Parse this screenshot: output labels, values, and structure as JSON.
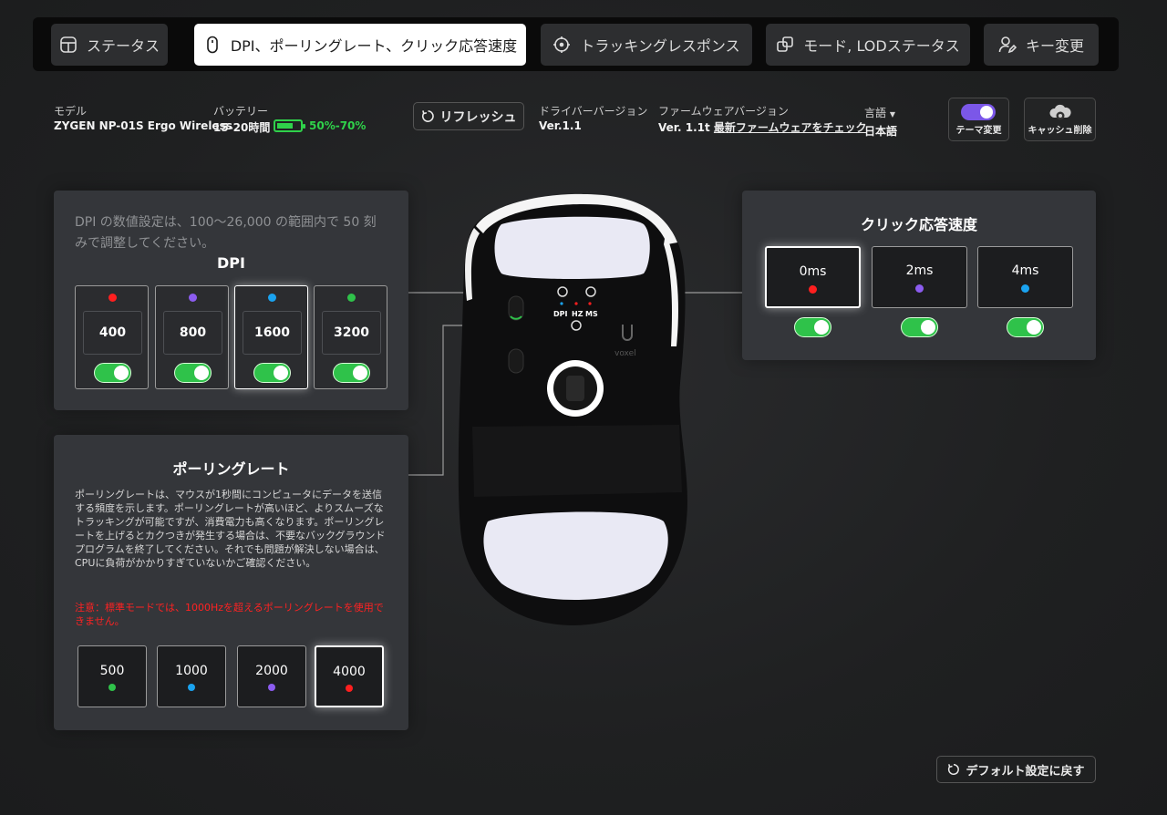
{
  "nav": {
    "tabs": [
      {
        "label": "ステータス",
        "icon": "layout-icon",
        "active": false
      },
      {
        "label": "DPI、ポーリングレート、クリック応答速度",
        "icon": "mouse-icon",
        "active": true
      },
      {
        "label": "トラッキングレスポンス",
        "icon": "crosshair-icon",
        "active": false
      },
      {
        "label": "モード, LODステータス",
        "icon": "copy-icon",
        "active": false
      },
      {
        "label": "キー変更",
        "icon": "user-edit-icon",
        "active": false
      }
    ]
  },
  "info": {
    "model_label": "モデル",
    "model_value": "ZYGEN NP-01S Ergo Wireless",
    "battery_label": "バッテリー",
    "battery_value": "15-20時間",
    "battery_percent": "50%-70%",
    "battery_color": "#2fd14a",
    "refresh_label": "リフレッシュ",
    "driver_label": "ドライバーバージョン",
    "driver_value": "Ver.1.1",
    "firmware_label": "ファームウェアバージョン",
    "firmware_value": "Ver. 1.1t",
    "firmware_link": "最新ファームウェアをチェック",
    "language_label": "言語",
    "language_value": "日本語",
    "theme_button": "テーマ変更",
    "cache_button": "キャッシュ削除"
  },
  "dpi": {
    "description": "DPI の数値設定は、100〜26,000 の範囲内で 50 刻みで調整してください。",
    "title": "DPI",
    "levels": [
      {
        "value": "400",
        "color": "#ff1f1f",
        "enabled": true,
        "selected": false
      },
      {
        "value": "800",
        "color": "#8c5cf0",
        "enabled": true,
        "selected": false
      },
      {
        "value": "1600",
        "color": "#1aa3f0",
        "enabled": true,
        "selected": true
      },
      {
        "value": "3200",
        "color": "#2fc24a",
        "enabled": true,
        "selected": false
      }
    ]
  },
  "polling": {
    "title": "ポーリングレート",
    "description": "ポーリングレートは、マウスが1秒間にコンピュータにデータを送信する頻度を示します。ポーリングレートが高いほど、よりスムーズなトラッキングが可能ですが、消費電力も高くなります。ポーリングレートを上げるとカクつきが発生する場合は、不要なバックグラウンドプログラムを終了してください。それでも問題が解決しない場合は、CPUに負荷がかかりすぎていないかご確認ください。",
    "warning": "注意：標準モードでは、1000Hzを超えるポーリングレートを使用できません。",
    "rates": [
      {
        "value": "500",
        "color": "#2fc24a",
        "selected": false
      },
      {
        "value": "1000",
        "color": "#1aa3f0",
        "selected": false
      },
      {
        "value": "2000",
        "color": "#8c5cf0",
        "selected": false
      },
      {
        "value": "4000",
        "color": "#ff1f1f",
        "selected": true
      }
    ]
  },
  "click": {
    "title": "クリック応答速度",
    "options": [
      {
        "value": "0ms",
        "color": "#ff1f1f",
        "enabled": true,
        "selected": true
      },
      {
        "value": "2ms",
        "color": "#8c5cf0",
        "enabled": true,
        "selected": false
      },
      {
        "value": "4ms",
        "color": "#1aa3f0",
        "enabled": true,
        "selected": false
      }
    ]
  },
  "mouse": {
    "labels": [
      "DPI",
      "HZ",
      "MS"
    ],
    "brand_text": "voxel"
  },
  "default_button": "デフォルト設定に戻す"
}
